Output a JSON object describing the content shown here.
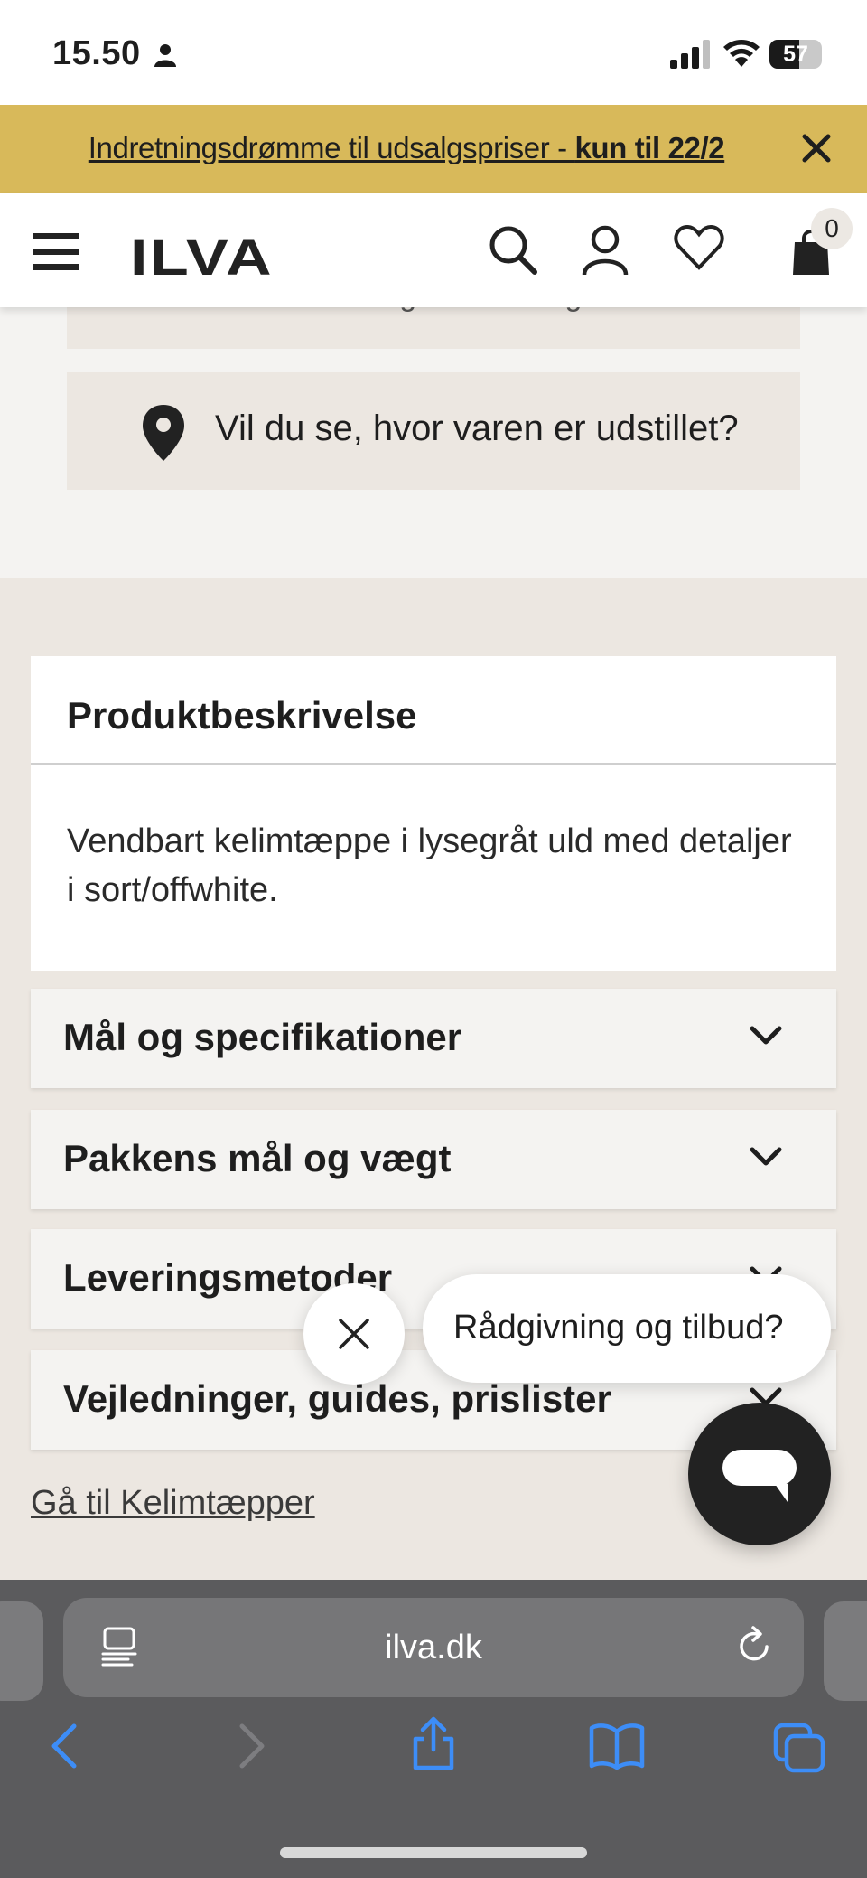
{
  "status_bar": {
    "time": "15.50",
    "battery": "57",
    "icons": [
      "person-icon",
      "signal-icon",
      "wifi-icon",
      "battery-icon"
    ]
  },
  "promo_banner": {
    "text": "Indretningsdrømme til udsalgspriser - ",
    "highlight": "kun til 22/2",
    "background": "#d8b95a"
  },
  "header": {
    "logo": "ILVA",
    "cart_count": "0",
    "icons": [
      "menu-icon",
      "search-icon",
      "account-icon",
      "heart-icon",
      "bag-icon"
    ]
  },
  "page": {
    "partial_box_text": "Varer klar til afhentning i udlevering",
    "showroom_label": "Vil du se, hvor varen er udstillet?",
    "description": {
      "title": "Produktbeskrivelse",
      "text": "Vendbart kelimtæppe i lysegråt uld med detaljer i sort/offwhite."
    },
    "accordions": [
      {
        "label": "Mål og specifikationer"
      },
      {
        "label": "Pakkens mål og vægt"
      },
      {
        "label": "Leveringsmetoder"
      },
      {
        "label": "Vejledninger, guides, prislister"
      }
    ],
    "category_link": "Gå til Kelimtæpper"
  },
  "chat": {
    "prompt": "Rådgivning og tilbud?"
  },
  "browser": {
    "url": "ilva.dk"
  }
}
